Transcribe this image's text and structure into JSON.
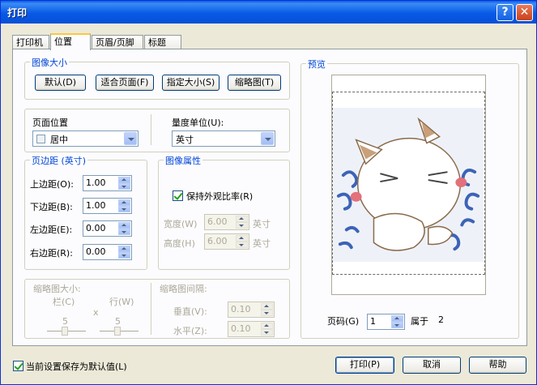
{
  "window": {
    "title": "打印",
    "help_glyph": "?",
    "close_glyph": "✕"
  },
  "tabs": [
    {
      "label": "打印机"
    },
    {
      "label": "位置"
    },
    {
      "label": "页眉/页脚"
    },
    {
      "label": "标题"
    }
  ],
  "image_size": {
    "title": "图像大小",
    "buttons": {
      "default": "默认(D)",
      "fit_page": "适合页面(F)",
      "custom": "指定大小(S)",
      "thumbnail": "缩略图(T)"
    }
  },
  "page_position": {
    "label": "页面位置",
    "value": "居中"
  },
  "unit": {
    "label": "量度单位(U):",
    "value": "英寸"
  },
  "margins": {
    "title": "页边距 (英寸)",
    "top": {
      "label": "上边距(O):",
      "value": "1.00"
    },
    "bottom": {
      "label": "下边距(B):",
      "value": "1.00"
    },
    "left": {
      "label": "左边距(E):",
      "value": "0.00"
    },
    "right": {
      "label": "右边距(R):",
      "value": "0.00"
    }
  },
  "image_props": {
    "title": "图像属性",
    "keep_ratio": {
      "label": "保持外观比率(R)",
      "checked": true
    },
    "width": {
      "label": "宽度(W)",
      "value": "6.00",
      "unit": "英寸"
    },
    "height": {
      "label": "高度(H)",
      "value": "6.00",
      "unit": "英寸"
    }
  },
  "thumb_size": {
    "title": "缩略图大小:",
    "col_label": "栏(C)",
    "row_label": "行(W)",
    "times": "x",
    "col_value": "5",
    "row_value": "5"
  },
  "thumb_spacing": {
    "title": "缩略图间隔:",
    "vertical": {
      "label": "垂直(V):",
      "value": "0.10"
    },
    "horizontal": {
      "label": "水平(Z):",
      "value": "0.10"
    }
  },
  "preview": {
    "title": "预览",
    "page_label": "页码(G)",
    "page_value": "1",
    "of_label": "属于",
    "total": "2"
  },
  "footer": {
    "save_default": {
      "label": "当前设置保存为默认值(L)",
      "checked": true
    },
    "print": "打印(P)",
    "cancel": "取消",
    "help": "帮助"
  }
}
